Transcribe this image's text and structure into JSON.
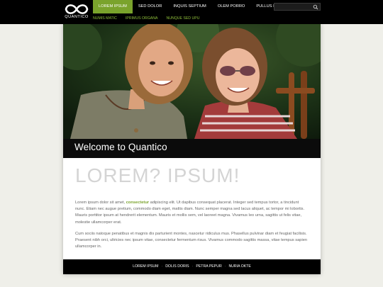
{
  "site": {
    "logo_text": "QUANTICO"
  },
  "nav": {
    "items": [
      {
        "label": "LOREM IPSUM",
        "active": true
      },
      {
        "label": "SED DOLOR",
        "active": false
      },
      {
        "label": "INQUIS SEPTIUM",
        "active": false
      },
      {
        "label": "OLEM PORRO",
        "active": false
      },
      {
        "label": "PULLUS IMPOUS",
        "active": false
      }
    ],
    "sub_items": [
      "NUMIS MATIC",
      "IPRIMUS ORGANA",
      "NUNQUE SED UPU"
    ]
  },
  "search": {
    "placeholder": "",
    "value": ""
  },
  "hero": {
    "caption": "Welcome to Quantico"
  },
  "content": {
    "headline": "LOREM? IPSUM!",
    "p1_before": "Lorem ipsum dolor sit amet, ",
    "p1_link": "consectetur",
    "p1_after": " adipiscing elit. Ut dapibus consequat placerat. Integer sed tempus tortor, a tincidunt nunc. Etiam nec augue pretium, commodo diam eget, mattis diam. Nunc semper magna sed lacus aliquet, ac tempor mi lobortis. Mauris porttitor ipsum at hendrerit elementum. Mauris et mollis sem, vel laoreet magna. Vivamus leo urna, sagittis ut felis vitae, molestie ullamcorper erat.",
    "p2": "Cum sociis natoque penatibus et magnis dis parturient montes, nascetur ridiculus mus. Phasellus pulvinar diam et feugiat facilisis. Praesent nibh orci, ultricies nec ipsum vitae, consectetur fermentum risus. Vivamus commodo sagittis massa, vitae tempus sapien ullamcorper in."
  },
  "footer": {
    "links": [
      "LOREM IPSUM",
      "DOLIS DORIS",
      "PETRA PEPUR",
      "NURIA OKTE"
    ]
  },
  "colors": {
    "accent": "#7aa32c",
    "topbar": "#000000",
    "background": "#efefe9"
  }
}
